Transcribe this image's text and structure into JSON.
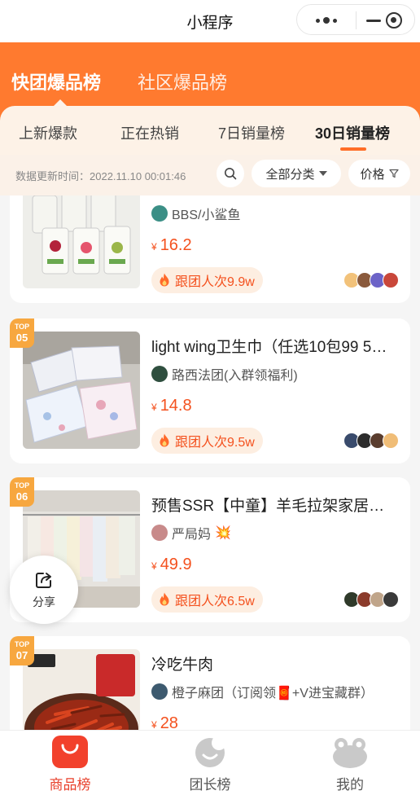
{
  "app": {
    "title": "小程序"
  },
  "main_tabs": [
    {
      "label": "快团爆品榜",
      "active": true
    },
    {
      "label": "社区爆品榜",
      "active": false
    }
  ],
  "sub_tabs": [
    {
      "label": "上新爆款",
      "active": false
    },
    {
      "label": "正在热销",
      "active": false
    },
    {
      "label": "7日销量榜",
      "active": false
    },
    {
      "label": "30日销量榜",
      "active": true
    }
  ],
  "filter": {
    "update_time": "数据更新时间：2022.11.10 00:01:46",
    "category_label": "全部分类",
    "price_label": "价格"
  },
  "products": [
    {
      "rank_top": "",
      "rank_num": "",
      "title": "",
      "shop": "BBS/小鲨鱼",
      "currency": "¥",
      "price": "16.2",
      "follow": "跟团人次9.9w"
    },
    {
      "rank_top": "TOP",
      "rank_num": "05",
      "title": "light wing卫生巾（任选10包99 5包…",
      "shop": "路西法团(入群领福利)",
      "currency": "¥",
      "price": "14.8",
      "follow": "跟团人次9.5w"
    },
    {
      "rank_top": "TOP",
      "rank_num": "06",
      "title": "预售SSR【中童】羊毛拉架家居服…",
      "shop": "严局妈",
      "shop_emoji": "💥",
      "currency": "¥",
      "price": "49.9",
      "follow": "跟团人次6.5w"
    },
    {
      "rank_top": "TOP",
      "rank_num": "07",
      "title": "冷吃牛肉",
      "shop": "橙子麻团（订阅领🧧+V进宝藏群）",
      "currency": "¥",
      "price": "28",
      "follow": ""
    }
  ],
  "share": {
    "label": "分享"
  },
  "bottom_nav": [
    {
      "label": "商品榜",
      "active": true
    },
    {
      "label": "团长榜",
      "active": false
    },
    {
      "label": "我的",
      "active": false
    }
  ],
  "colors": {
    "brand_orange": "#ff7a2f",
    "price_red": "#f4511e",
    "rank_badge": "#f7a73f",
    "nav_active": "#e8412c"
  }
}
